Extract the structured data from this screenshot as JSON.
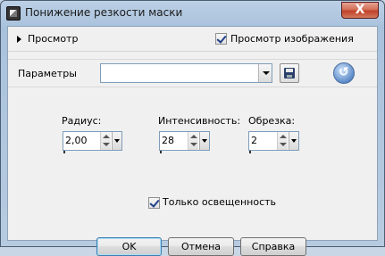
{
  "window": {
    "title": "Понижение резкости маски",
    "close_label": "X"
  },
  "preview": {
    "label": "Просмотр",
    "image_preview_label": "Просмотр изображения",
    "image_preview_checked": true
  },
  "params": {
    "label": "Параметры",
    "preset_value": ""
  },
  "fields": {
    "radius": {
      "label": "Радиус:",
      "value": "2,00"
    },
    "intensity": {
      "label": "Интенсивность:",
      "value": "28"
    },
    "clip": {
      "label": "Обрезка:",
      "value": "2"
    }
  },
  "luminance": {
    "label": "Только освещенность",
    "checked": true
  },
  "buttons": {
    "ok": "OK",
    "cancel": "Отмена",
    "help": "Справка"
  },
  "colors": {
    "title_bar": "#a9c2dc",
    "client_bg": "#f0f0f0",
    "close_button": "#c1412a",
    "default_button_border": "#3c7fb1"
  },
  "icons": {
    "app": "paint-shop-icon",
    "expand": "triangle-right-icon",
    "save": "floppy-disk-icon",
    "reset": "reset-circle-icon"
  }
}
